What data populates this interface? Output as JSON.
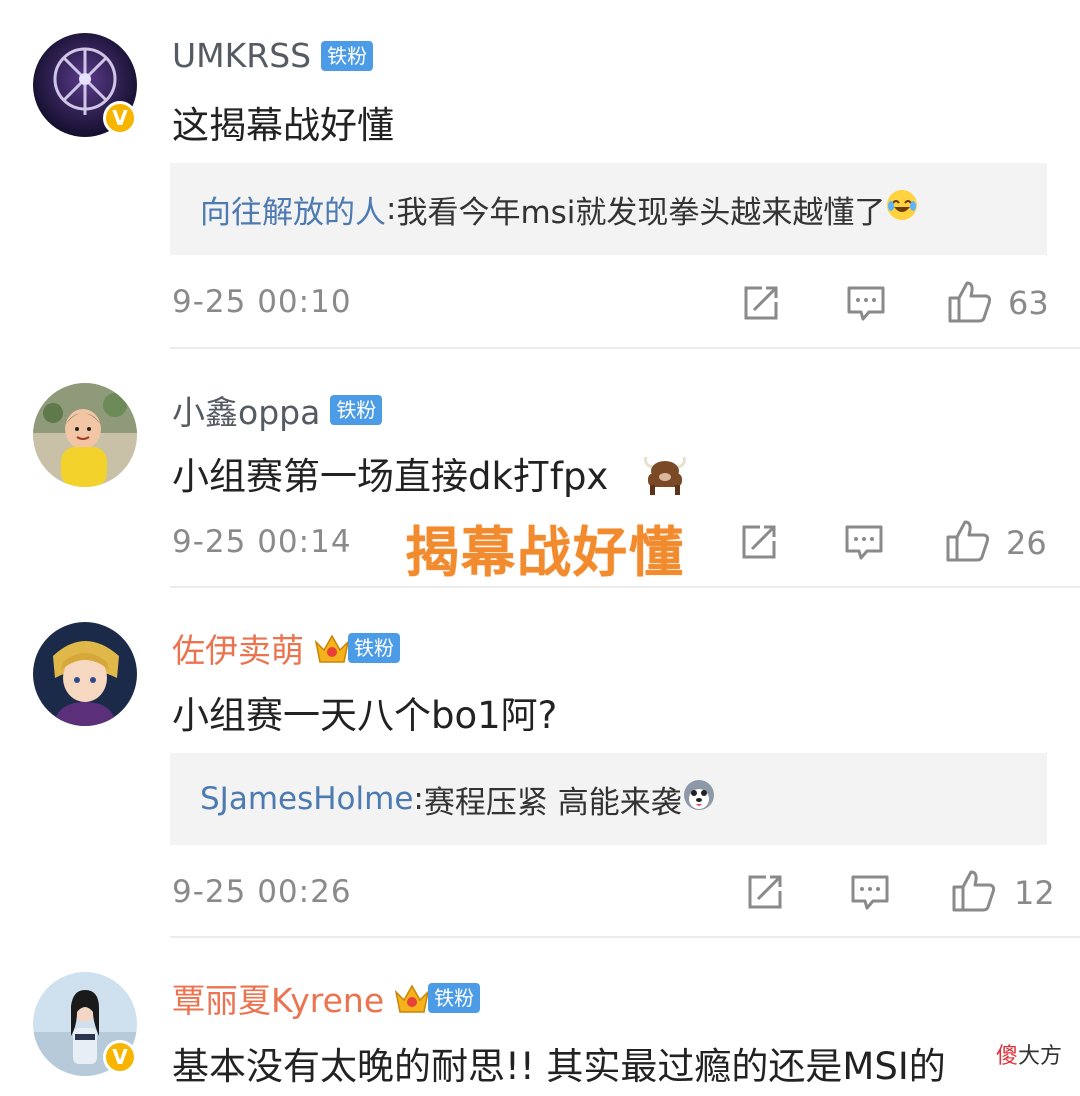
{
  "comments": [
    {
      "username": "UMKRSS",
      "badge": "铁粉",
      "content": "这揭幕战好懂",
      "reply": {
        "name": "向往解放的人",
        "sep": ": ",
        "text": "我看今年msi就发现拳头越来越懂了"
      },
      "time": "9-25 00:10",
      "likes": "63",
      "verified": true
    },
    {
      "username": "小鑫oppa",
      "badge": "铁粉",
      "content": "小组赛第一场直接dk打fpx",
      "time": "9-25 00:14",
      "likes": "26",
      "verified": false
    },
    {
      "username": "佐伊卖萌",
      "badge": "铁粉",
      "content": "小组赛一天八个bo1阿?",
      "reply": {
        "name": "SJamesHolme",
        "sep": ": ",
        "text": "赛程压紧  高能来袭"
      },
      "time": "9-25 00:26",
      "likes": "12",
      "verified": false
    },
    {
      "username": "覃丽夏Kyrene",
      "badge": "铁粉",
      "content": "基本没有太晚的耐思!! 其实最过瘾的还是MSI的",
      "verified": true
    }
  ],
  "overlay_text": "揭幕战好懂",
  "watermark": {
    "char": "傻",
    "text": "大方"
  },
  "colors": {
    "fan_badge": "#4b9be6",
    "username_gold": "#eb7350",
    "reply_name": "#4d7ab0",
    "overlay": "#f28a2e"
  }
}
